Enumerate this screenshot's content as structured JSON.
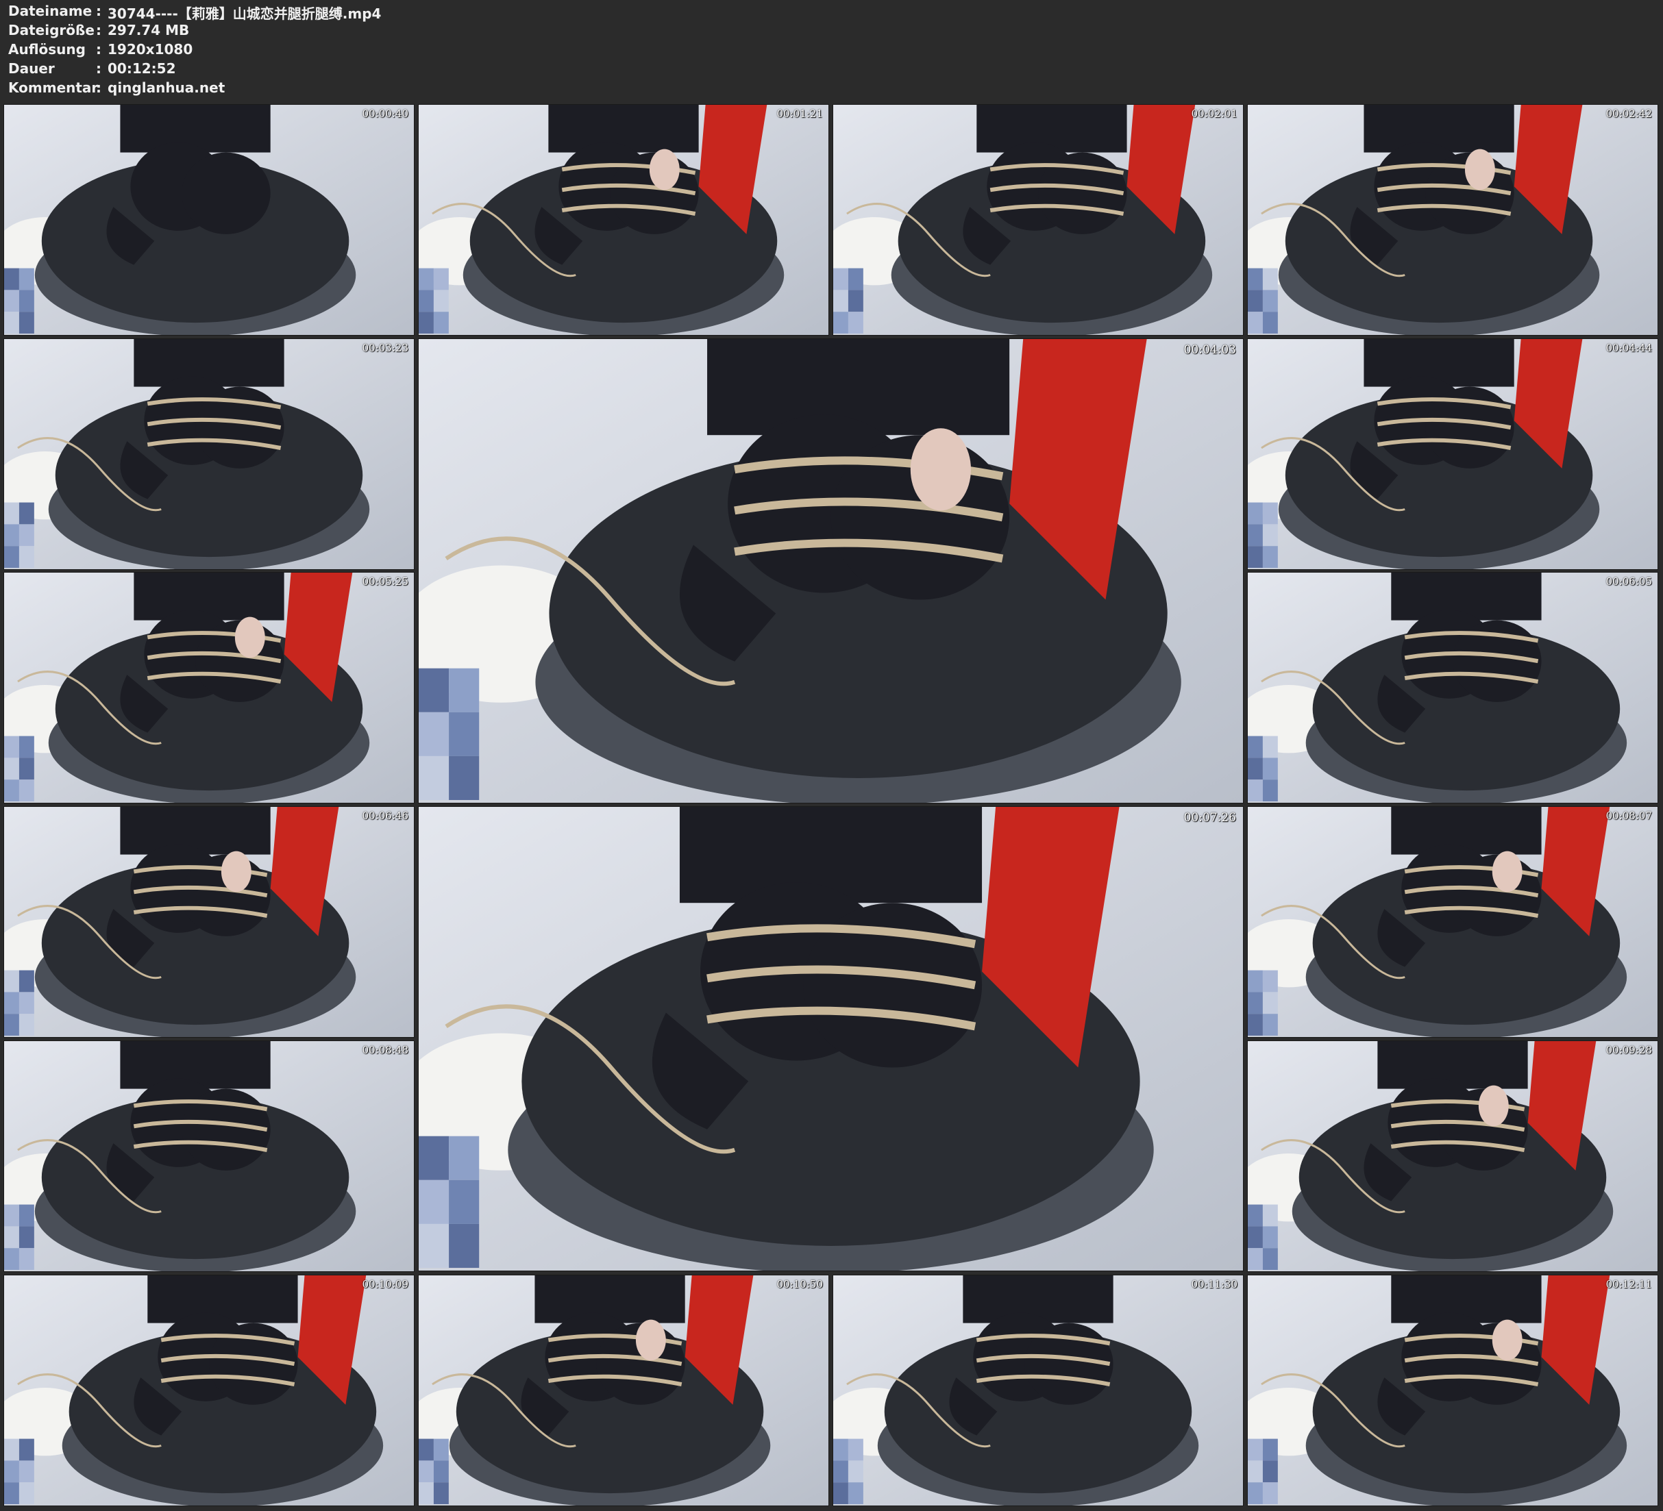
{
  "file_info": {
    "filename_label": "Dateiname",
    "filename_value": "30744----【莉雅】山城恋并腿折腿缚.mp4",
    "filesize_label": "Dateigröße",
    "filesize_value": "297.74 MB",
    "resolution_label": "Auflösung",
    "resolution_value": "1920x1080",
    "duration_label": "Dauer",
    "duration_value": "00:12:52",
    "comment_label": "Kommentar",
    "comment_value": "qinglanhua.net",
    "separator": ":"
  },
  "thumbnails": [
    {
      "timestamp": "00:00:40"
    },
    {
      "timestamp": "00:01:21"
    },
    {
      "timestamp": "00:02:01"
    },
    {
      "timestamp": "00:02:42"
    },
    {
      "timestamp": "00:03:23"
    },
    {
      "timestamp": "00:04:03"
    },
    {
      "timestamp": "00:04:44"
    },
    {
      "timestamp": "00:05:25"
    },
    {
      "timestamp": "00:06:05"
    },
    {
      "timestamp": "00:06:46"
    },
    {
      "timestamp": "00:07:26"
    },
    {
      "timestamp": "00:08:07"
    },
    {
      "timestamp": "00:08:48"
    },
    {
      "timestamp": "00:09:28"
    },
    {
      "timestamp": "00:10:09"
    },
    {
      "timestamp": "00:10:50"
    },
    {
      "timestamp": "00:11:30"
    },
    {
      "timestamp": "00:12:11"
    }
  ],
  "colors": {
    "background": "#2b2b2b",
    "text": "#f0f0f0",
    "studio_backdrop": "#cfd3dc",
    "platform": "#2a2d33",
    "clothing": "#1c1d24",
    "cape": "#c8261e",
    "rope": "#c9b89a"
  }
}
